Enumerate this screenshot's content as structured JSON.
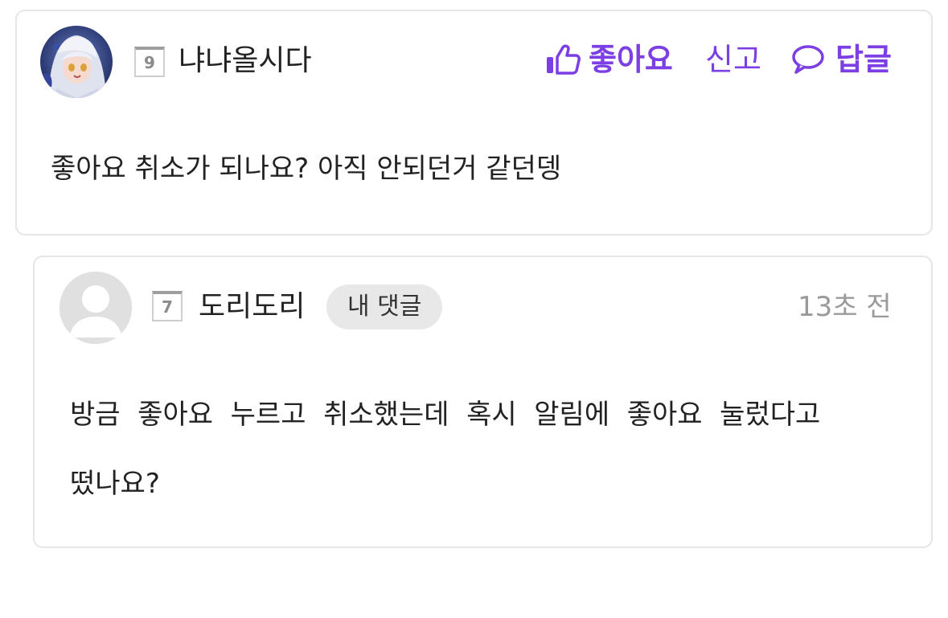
{
  "colors": {
    "accent": "#7b3fe4",
    "border": "#e6e6e6",
    "text": "#222222",
    "muted": "#9a9a9a",
    "badge_bg": "#e8e8e8"
  },
  "comments": [
    {
      "level": "9",
      "nickname": "냐냐올시다",
      "avatar_icon": "anime-character-avatar",
      "actions": {
        "like_label": "좋아요",
        "like_icon": "thumbs-up-icon",
        "report_label": "신고",
        "reply_label": "답글",
        "reply_icon": "speech-bubble-icon"
      },
      "text": "좋아요 취소가 되나요? 아직 안되던거 같던뎅"
    },
    {
      "level": "7",
      "nickname": "도리도리",
      "avatar_icon": "default-user-avatar",
      "badge": "내 댓글",
      "time": "13초 전",
      "text_lines": [
        "방금  좋아요  누르고  취소했는데  혹시  알림에  좋아요  눌렀다고",
        "떴나요?"
      ]
    }
  ]
}
